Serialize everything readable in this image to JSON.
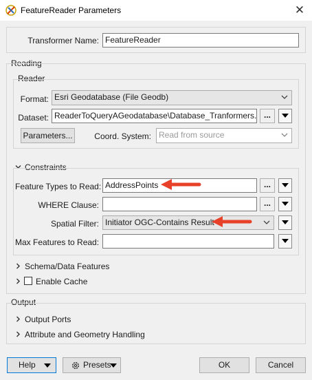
{
  "window": {
    "title": "FeatureReader Parameters",
    "close_glyph": "✕"
  },
  "transformer": {
    "label": "Transformer Name:",
    "value": "FeatureReader"
  },
  "reading": {
    "section_label": "Reading",
    "reader_label": "Reader",
    "format_label": "Format:",
    "format_value": "Esri Geodatabase (File Geodb)",
    "dataset_label": "Dataset:",
    "dataset_value": "ReaderToQueryAGeodatabase\\Database_Tranformers.gdb\"",
    "parameters_button": "Parameters...",
    "coord_label": "Coord. System:",
    "coord_value": "Read from source",
    "ellipsis": "..."
  },
  "constraints": {
    "section_label": "Constraints",
    "feature_types_label": "Feature Types to Read:",
    "feature_types_value": "AddressPoints",
    "where_label": "WHERE Clause:",
    "where_value": "",
    "spatial_label": "Spatial Filter:",
    "spatial_value": "Initiator OGC-Contains Result",
    "max_label": "Max Features to Read:",
    "max_value": ""
  },
  "schema": {
    "label": "Schema/Data Features"
  },
  "cache": {
    "label": "Enable Cache"
  },
  "output": {
    "section_label": "Output",
    "ports_label": "Output Ports",
    "attr_label": "Attribute and Geometry Handling"
  },
  "footer": {
    "help": "Help",
    "presets": "Presets",
    "ok": "OK",
    "cancel": "Cancel"
  },
  "colors": {
    "annotation_arrow": "#e8412a",
    "accent_border": "#0078d7"
  }
}
